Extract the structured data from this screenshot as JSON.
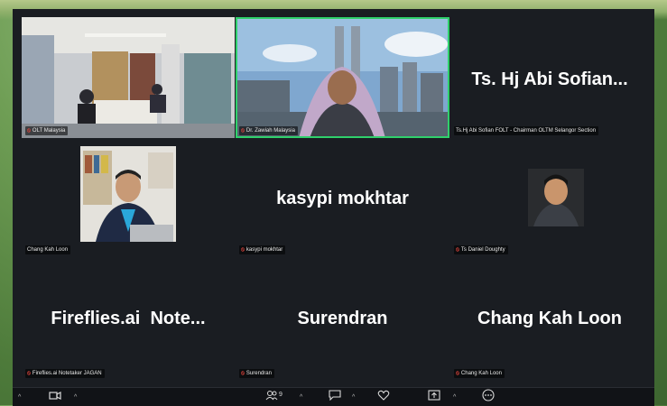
{
  "tiles": {
    "room": {
      "caption": "OLT Malaysia"
    },
    "speaker": {
      "caption": "Dr. Zawiah Malaysia"
    },
    "abi": {
      "display_name": "Ts. Hj Abi Sofian...",
      "caption": "Ts.Hj Abi Sofian FOLT - Chairman OLTM Selangor Section"
    },
    "chang_video": {
      "caption": "Chang Kah Loon"
    },
    "kasypi": {
      "display_name": "kasypi mokhtar",
      "caption": "kasypi mokhtar"
    },
    "daniel": {
      "caption": "Ts Daniel Doughty"
    },
    "fireflies": {
      "display_name": "Fireflies.ai  Note...",
      "caption": "Fireflies.ai Notetaker JAGAN"
    },
    "surendran": {
      "display_name": "Surendran",
      "caption": "Surendran"
    },
    "chang_name": {
      "display_name": "Chang Kah Loon",
      "caption": "Chang Kah Loon"
    }
  },
  "toolbar": {
    "participants_count": "9"
  },
  "colors": {
    "background": "#1a1d22",
    "active_speaker_border": "#2fd06b",
    "muted_mic": "#e0443c"
  }
}
